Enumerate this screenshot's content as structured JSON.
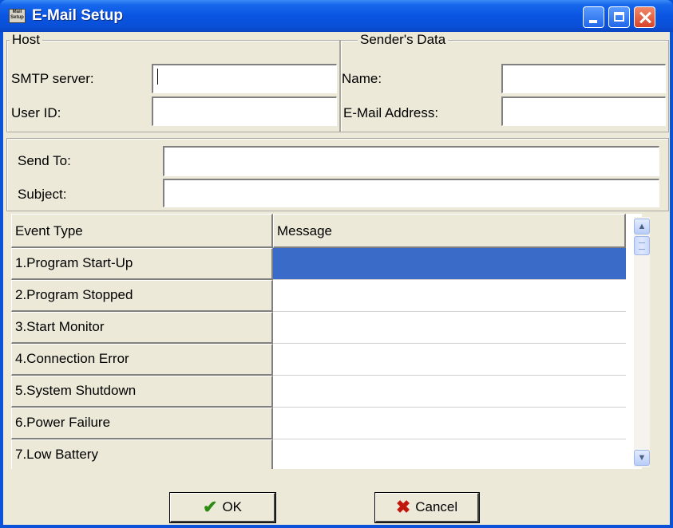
{
  "window": {
    "title": "E-Mail Setup",
    "icon_text": "Mail Setup",
    "icon": "mail-setup-icon"
  },
  "host": {
    "legend": "Host",
    "smtp_label": "SMTP server:",
    "smtp_value": "",
    "userid_label": "User ID:",
    "userid_value": ""
  },
  "sender": {
    "legend": "Sender's Data",
    "name_label": "Name:",
    "name_value": "",
    "email_label": "E-Mail Address:",
    "email_value": ""
  },
  "message": {
    "sendto_label": "Send To:",
    "sendto_value": "",
    "subject_label": "Subject:",
    "subject_value": ""
  },
  "grid": {
    "columns": [
      "Event Type",
      "Message"
    ],
    "rows": [
      {
        "event": "1.Program Start-Up",
        "message": ""
      },
      {
        "event": "2.Program Stopped",
        "message": ""
      },
      {
        "event": "3.Start Monitor",
        "message": ""
      },
      {
        "event": "4.Connection Error",
        "message": ""
      },
      {
        "event": "5.System Shutdown",
        "message": ""
      },
      {
        "event": "6.Power Failure",
        "message": ""
      },
      {
        "event": "7.Low Battery",
        "message": ""
      }
    ],
    "selected_row": 1
  },
  "buttons": {
    "ok_label": "OK",
    "ok_icon": "checkmark-icon",
    "cancel_label": "Cancel",
    "cancel_icon": "x-icon"
  },
  "colors": {
    "titlebar": "#0a55e2",
    "selection": "#3a6bc9",
    "face": "#ece9d8"
  }
}
